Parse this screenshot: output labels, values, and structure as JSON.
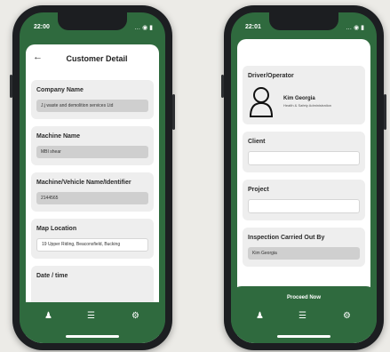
{
  "left_phone": {
    "status": {
      "time": "22:00",
      "icons": "… ◉ ▮"
    },
    "header": {
      "back": "←",
      "title": "Customer Detail"
    },
    "fields": [
      {
        "label": "Company Name",
        "value": "J.j waste and demolition services Ltd"
      },
      {
        "label": "Machine Name",
        "value": "MBI shear"
      },
      {
        "label": "Machine/Vehicle Name/Identifier",
        "value": "2144565"
      },
      {
        "label": "Map Location",
        "value": "19 Upper Riding, Beaconsfield, Bucking"
      },
      {
        "label": "Date / time",
        "value": ""
      }
    ],
    "tabs": {
      "person": "♟",
      "list": "☰",
      "settings": "⚙"
    }
  },
  "right_phone": {
    "status": {
      "time": "22:01",
      "icons": "… ◉ ▮"
    },
    "driver": {
      "label": "Driver/Operator",
      "name": "Kim Georgia",
      "role": "Health & Safety Administration"
    },
    "client": {
      "label": "Client",
      "value": ""
    },
    "project": {
      "label": "Project",
      "value": ""
    },
    "inspection": {
      "label": "Inspection Carried Out By",
      "value": "Kim Georgia"
    },
    "proceed": "Proceed Now",
    "tabs": {
      "person": "♟",
      "list": "☰",
      "settings": "⚙"
    }
  },
  "colors": {
    "brand_green": "#2f6a3e",
    "card_bg": "#eeeeee",
    "value_bg": "#cfcfcf"
  }
}
